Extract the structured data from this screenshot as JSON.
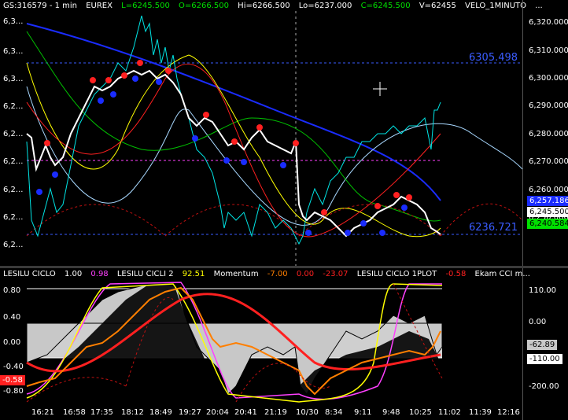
{
  "header": {
    "symbol": "GS:316579 - 1 min",
    "exchange": "EUREX",
    "last": "L=6245.500",
    "open": "O=6266.500",
    "high": "Hi=6266.500",
    "low": "Lo=6237.000",
    "close": "C=6245.500",
    "volume": "V=62455",
    "indicator": "VELO_1MINUTO",
    "more": "..."
  },
  "price_axis": {
    "ticks": [
      "6,320.000",
      "6,310.000",
      "6,300.000",
      "6,290.000",
      "6,280.000",
      "6,270.000",
      "6,260.000",
      "6,250.000"
    ],
    "left_ticks": [
      "6,3...",
      "6,3...",
      "6,3...",
      "6,2...",
      "6,2...",
      "6,2...",
      "6,2...",
      "6,2...",
      "6,2..."
    ],
    "level_high": "6305.498",
    "level_low": "6236.721",
    "badge_blue": "6,257.186",
    "badge_white": "6,245.500",
    "badge_green": "6,240.584"
  },
  "lower_header": {
    "name1": "LESILU CICLO",
    "val1a": "1.00",
    "val1b": "0.98",
    "name2": "LESILU CICLI 2",
    "val2": "92.51",
    "name3": "Momentum",
    "val3a": "-7.00",
    "val3b": "0.00",
    "val3c": "-23.07",
    "name4": "LESILU CICLO 1PLOT",
    "val4": "-0.58",
    "name5": "Ekam CCI m..."
  },
  "lower_axis": {
    "left_ticks": [
      "0.80",
      "0.40",
      "0.00",
      "-0.40",
      "-0.80"
    ],
    "left_badge": "-0.58",
    "right_ticks": [
      "110.00",
      "0.00",
      "-110.00",
      "-200.00"
    ],
    "right_badge": "-62.89"
  },
  "time_axis": [
    "16:21",
    "16:58",
    "17:35",
    "18:12",
    "18:49",
    "19:27",
    "20:04",
    "20:41",
    "21:19",
    "10/30",
    "8:34",
    "9:11",
    "9:48",
    "10:25",
    "11:02",
    "11:39",
    "12:16"
  ],
  "colors": {
    "price": "#ffffff",
    "cyan": "#00e5e5",
    "blue": "#1a2cff",
    "red": "#ff2020",
    "yellow": "#ffff00",
    "green": "#00c000",
    "light_blue": "#a8d8ff",
    "magenta": "#ff40ff",
    "orange": "#ff7f00",
    "gray_fill": "#c8c8c8"
  }
}
